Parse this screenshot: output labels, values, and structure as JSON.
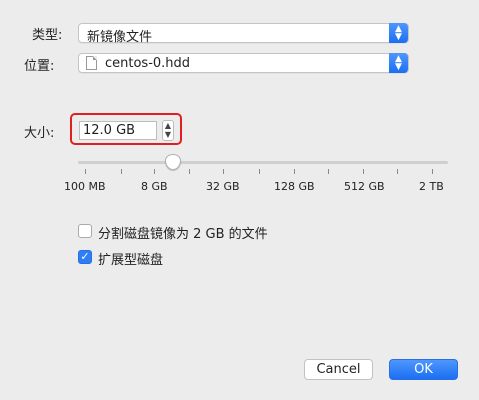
{
  "type_row": {
    "label": "类型:",
    "value": "新镜像文件"
  },
  "location_row": {
    "label": "位置:",
    "value": "centos-0.hdd"
  },
  "size_row": {
    "label": "大小:",
    "value": "12.0 GB",
    "slider_fraction": 0.25
  },
  "slider_ticks": [
    "100 MB",
    "8 GB",
    "32 GB",
    "128 GB",
    "512 GB",
    "2 TB"
  ],
  "options": {
    "split_label": "分割磁盘镜像为 2 GB 的文件",
    "split_checked": false,
    "expand_label": "扩展型磁盘",
    "expand_checked": true
  },
  "buttons": {
    "cancel": "Cancel",
    "ok": "OK"
  },
  "colors": {
    "accent": "#1b6ff2",
    "highlight": "#e02020",
    "background": "#ececec"
  }
}
